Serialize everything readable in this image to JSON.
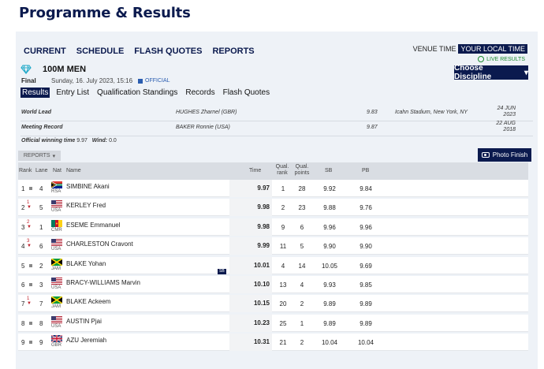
{
  "page": {
    "title": "Programme & Results"
  },
  "nav": [
    "CURRENT",
    "SCHEDULE",
    "FLASH QUOTES",
    "REPORTS"
  ],
  "venue_time": {
    "label": "VENUE TIME",
    "active": "YOUR LOCAL TIME"
  },
  "live_results": "LIVE RESULTS",
  "choose_discipline": "Choose Discipline",
  "event": {
    "name": "100M MEN",
    "round": "Final",
    "date": "Sunday, 16. July 2023, 15:16",
    "status": "OFFICIAL"
  },
  "tabs": [
    "Results",
    "Entry List",
    "Qualification Standings",
    "Records",
    "Flash Quotes"
  ],
  "records": [
    {
      "type": "World Lead",
      "athlete": "HUGHES Zharnel (GBR)",
      "mark": "9.83",
      "venue": "Icahn Stadium, New York, NY",
      "date_line1": "24 JUN",
      "date_line2": "2023"
    },
    {
      "type": "Meeting Record",
      "athlete": "BAKER Ronnie (USA)",
      "mark": "9.87",
      "venue": "",
      "date_line1": "22 AUG",
      "date_line2": "2018"
    }
  ],
  "official_winning_time": {
    "label": "Official winning time",
    "value": "9.97",
    "wind_label": "Wind:",
    "wind_value": "0.0"
  },
  "reports_label": "REPORTS",
  "photo_finish": "Photo Finish",
  "table_headers": {
    "rank": "Rank",
    "lane": "Lane",
    "nat": "Nat",
    "name": "Name",
    "time": "Time",
    "qual_rank_1": "Qual.",
    "qual_rank_2": "rank",
    "qual_points_1": "Qual.",
    "qual_points_2": "points",
    "sb": "SB",
    "pb": "PB"
  },
  "sb_badge": "SB",
  "results": [
    {
      "rank": "1",
      "change": "",
      "lane": "4",
      "nat": "RSA",
      "name": "SIMBINE Akani",
      "time": "9.97",
      "qual_rank": "1",
      "qual_points": "28",
      "sb": "9.92",
      "pb": "9.84"
    },
    {
      "rank": "2",
      "change": "1",
      "lane": "5",
      "nat": "USA",
      "name": "KERLEY Fred",
      "time": "9.98",
      "qual_rank": "2",
      "qual_points": "23",
      "sb": "9.88",
      "pb": "9.76"
    },
    {
      "rank": "3",
      "change": "2",
      "lane": "1",
      "nat": "CMR",
      "name": "ESEME Emmanuel",
      "time": "9.98",
      "qual_rank": "9",
      "qual_points": "6",
      "sb": "9.96",
      "pb": "9.96"
    },
    {
      "rank": "4",
      "change": "3",
      "lane": "6",
      "nat": "USA",
      "name": "CHARLESTON Cravont",
      "time": "9.99",
      "qual_rank": "11",
      "qual_points": "5",
      "sb": "9.90",
      "pb": "9.90"
    },
    {
      "rank": "5",
      "change": "",
      "lane": "2",
      "nat": "JAM",
      "name": "BLAKE Yohan",
      "time": "10.01",
      "qual_rank": "4",
      "qual_points": "14",
      "sb": "10.05",
      "pb": "9.69"
    },
    {
      "rank": "6",
      "change": "",
      "lane": "3",
      "nat": "USA",
      "name": "BRACY-WILLIAMS Marvin",
      "time": "10.10",
      "qual_rank": "13",
      "qual_points": "4",
      "sb": "9.93",
      "pb": "9.85"
    },
    {
      "rank": "7",
      "change": "1",
      "lane": "7",
      "nat": "JAM",
      "name": "BLAKE Ackeem",
      "time": "10.15",
      "qual_rank": "20",
      "qual_points": "2",
      "sb": "9.89",
      "pb": "9.89"
    },
    {
      "rank": "8",
      "change": "",
      "lane": "8",
      "nat": "USA",
      "name": "AUSTIN Pjai",
      "time": "10.23",
      "qual_rank": "25",
      "qual_points": "1",
      "sb": "9.89",
      "pb": "9.89"
    },
    {
      "rank": "9",
      "change": "",
      "lane": "9",
      "nat": "GBR",
      "name": "AZU Jeremiah",
      "time": "10.31",
      "qual_rank": "21",
      "qual_points": "2",
      "sb": "10.04",
      "pb": "10.04"
    }
  ],
  "colors": {
    "navy": "#0b1a4e",
    "live_green": "#1a8a2e",
    "rank_change": "#c0212c"
  }
}
